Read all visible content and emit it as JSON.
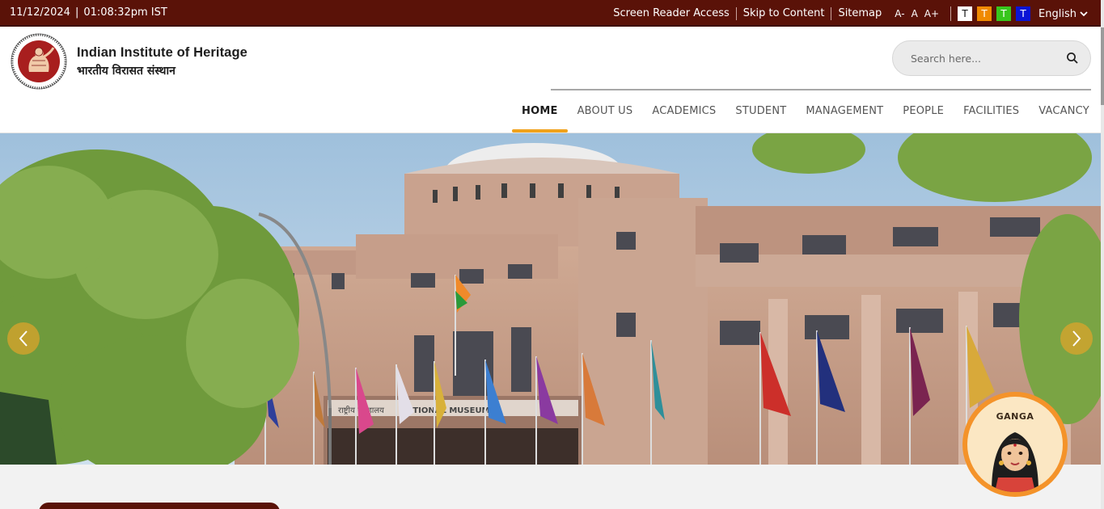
{
  "topbar": {
    "date": "11/12/2024",
    "separator": "|",
    "time": "01:08:32pm IST",
    "links": {
      "screen_reader": "Screen Reader Access",
      "skip_content": "Skip to Content",
      "sitemap": "Sitemap"
    },
    "font_sizes": {
      "small": "A-",
      "normal": "A",
      "large": "A+"
    },
    "theme_letter": "T",
    "theme_colors": [
      "#ffffff",
      "#f08a00",
      "#37c61d",
      "#0b14d6"
    ],
    "language": "English"
  },
  "header": {
    "brand_en": "Indian Institute of Heritage",
    "brand_hi": "भारतीय विरासत संस्थान",
    "search_placeholder": "Search here..."
  },
  "nav": {
    "items": [
      "HOME",
      "ABOUT US",
      "ACADEMICS",
      "STUDENT",
      "MANAGEMENT",
      "PEOPLE",
      "FACILITIES",
      "VACANCY"
    ],
    "active": "HOME"
  },
  "hero": {
    "building_sign_upper": "राष्ट्रीय संग्रहालय",
    "building_sign_lower": "NATIONAL MUSEUM"
  },
  "bot": {
    "name": "GANGA"
  },
  "colors": {
    "topbar": "#5a1208",
    "accent": "#f0a21b",
    "bot": "#f4932a"
  }
}
